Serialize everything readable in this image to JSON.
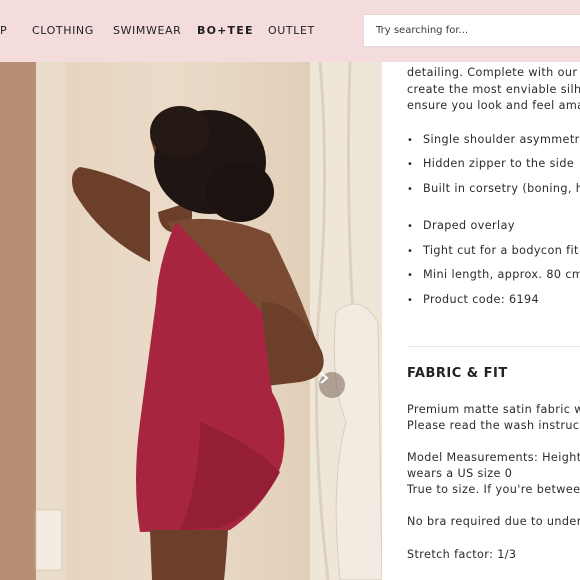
{
  "nav": {
    "items": [
      "P",
      "CLOTHING",
      "SWIMWEAR",
      "BO+TEE",
      "OUTLET"
    ],
    "search_placeholder": "Try searching for..."
  },
  "colors": {
    "nav_bg": "#f4dcdd",
    "dress": "#a8253f"
  },
  "carousel": {
    "next_icon": "chevron-right-icon"
  },
  "description": {
    "lines": [
      "detailing. Complete with our",
      "create the most enviable silh",
      "ensure you look and feel ama"
    ],
    "bullets": [
      "Single shoulder asymmetri",
      "Hidden zipper to the side",
      "Built in corsetry (boning, h",
      "Draped overlay",
      "Tight cut for a bodycon fit",
      "Mini length, approx. 80 cm",
      "Product code: 6194"
    ]
  },
  "fabric": {
    "title": "FABRIC & FIT",
    "lines": [
      "Premium matte satin fabric w",
      "Please read the wash instruc",
      "Model Measurements: Height",
      "wears a US size 0",
      "True to size. If you're betwee",
      "No bra required due to under",
      "Stretch factor: 1/3"
    ]
  }
}
